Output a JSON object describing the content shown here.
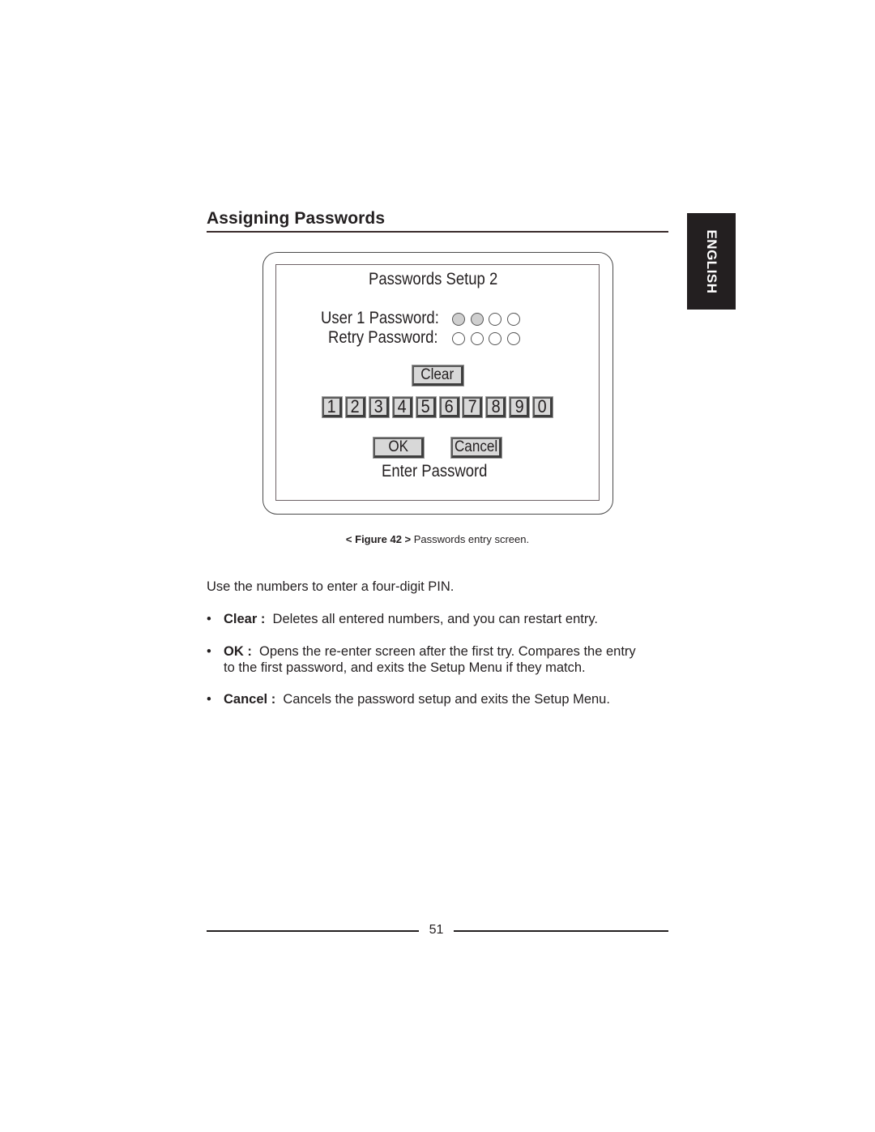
{
  "document": {
    "heading": "Assigning Passwords",
    "language_tab": "ENGLISH",
    "page_number": "51"
  },
  "figure": {
    "screen": {
      "title": "Passwords Setup  2",
      "user1_label": "User 1 Password:",
      "retry_label": "Retry Password:",
      "user1_pin_slots": [
        true,
        true,
        false,
        false
      ],
      "retry_pin_slots": [
        false,
        false,
        false,
        false
      ],
      "pin_length": 4,
      "clear_label": "Clear",
      "keypad": [
        "1",
        "2",
        "3",
        "4",
        "5",
        "6",
        "7",
        "8",
        "9",
        "0"
      ],
      "ok_label": "OK",
      "cancel_label": "Cancel",
      "status": "Enter Password"
    },
    "caption": {
      "label": "< Figure 42 >",
      "text": " Passwords entry screen."
    }
  },
  "body": {
    "intro": "Use the numbers to enter a four-digit PIN.",
    "bullets": [
      {
        "term": "Clear :",
        "lines": [
          "Deletes all entered numbers, and you can restart entry."
        ]
      },
      {
        "term": "OK :",
        "lines": [
          "Opens the re-enter screen after the first try.  Compares the entry",
          "to the first password, and exits the Setup Menu if they match."
        ]
      },
      {
        "term": "Cancel :",
        "lines": [
          "Cancels the password setup and exits the Setup Menu."
        ]
      }
    ],
    "bullet_glyph": "•"
  }
}
